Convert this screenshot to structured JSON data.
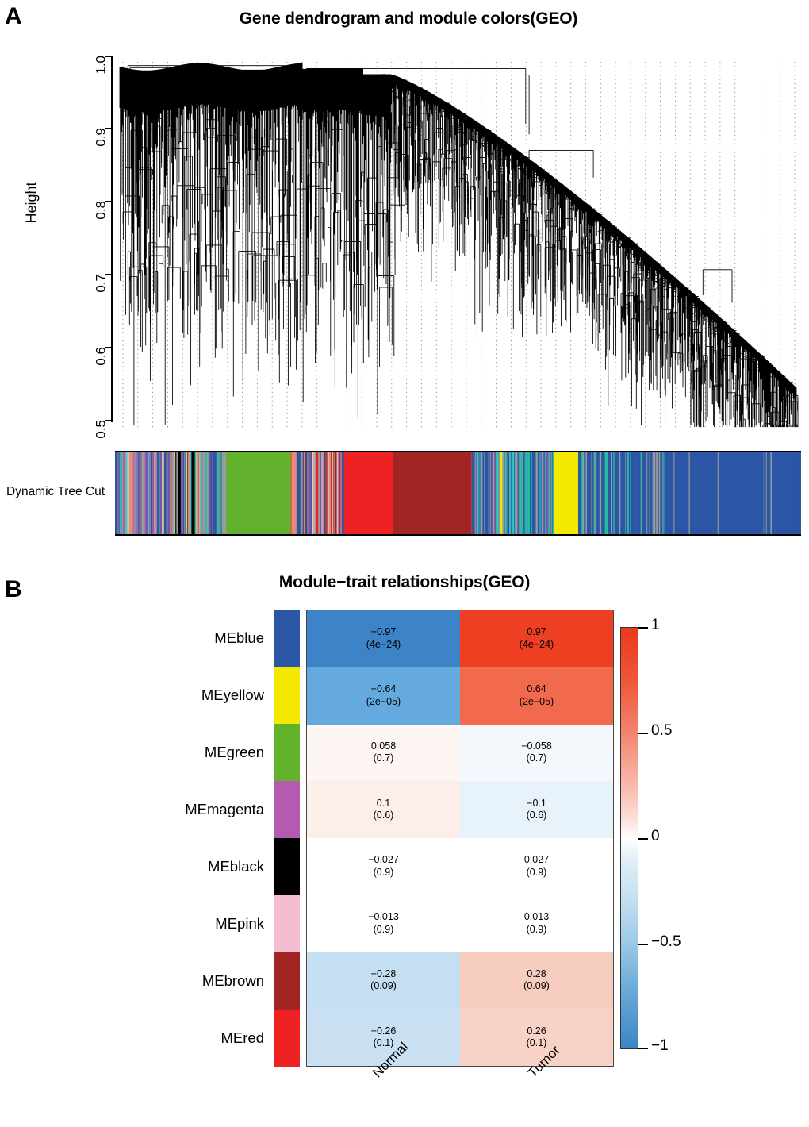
{
  "panels": {
    "a_letter": "A",
    "b_letter": "B"
  },
  "panel_a": {
    "title": "Gene dendrogram and module colors(GEO)",
    "y_axis_label": "Height",
    "y_ticks": [
      "1.0",
      "0.9",
      "0.8",
      "0.7",
      "0.6",
      "0.5"
    ],
    "tree_cut_label": "Dynamic Tree Cut",
    "module_colors": {
      "blue": "#2b56a5",
      "yellow": "#f2e800",
      "green": "#63b22e",
      "magenta": "#b35bb0",
      "black": "#000000",
      "pink": "#f4bcd0",
      "brown": "#a02523",
      "red": "#ee2222",
      "grey": "#9b9b9b",
      "tan": "#cfc49a",
      "salmon": "#e78a7a",
      "purple": "#7b55a5",
      "greenyellow": "#b8d430",
      "cyan": "#40c8c8",
      "turquoise": "#23bfa0"
    }
  },
  "chart_data": [
    {
      "type": "line",
      "name": "gene-dendrogram",
      "title": "Gene dendrogram and module colors(GEO)",
      "xlabel": "",
      "ylabel": "Height",
      "ylim": [
        0.5,
        1.0
      ],
      "yticks": [
        0.5,
        0.6,
        0.7,
        0.8,
        0.9,
        1.0
      ],
      "grid": "vertical dotted gridlines",
      "note": "Hierarchical clustering dendrogram of genes; merge heights between 0.50 and 1.00; dense leaves, large right-hand shoulder descending from ~0.98 to ~0.55",
      "module_color_track": {
        "label": "Dynamic Tree Cut",
        "segments": [
          {
            "color": "blue",
            "start": 0.0,
            "end": 0.028
          },
          {
            "color": "magenta",
            "start": 0.028,
            "end": 0.055
          },
          {
            "color": "blue",
            "start": 0.055,
            "end": 0.062
          },
          {
            "color": "tan",
            "start": 0.062,
            "end": 0.072
          },
          {
            "color": "black",
            "start": 0.072,
            "end": 0.128
          },
          {
            "color": "blue",
            "start": 0.128,
            "end": 0.155
          },
          {
            "color": "green",
            "start": 0.155,
            "end": 0.26
          },
          {
            "color": "blue",
            "start": 0.26,
            "end": 0.288
          },
          {
            "color": "pink",
            "start": 0.288,
            "end": 0.33
          },
          {
            "color": "red",
            "start": 0.33,
            "end": 0.405
          },
          {
            "color": "brown",
            "start": 0.405,
            "end": 0.52
          },
          {
            "color": "blue",
            "start": 0.52,
            "end": 0.56
          },
          {
            "color": "yellow",
            "start": 0.56,
            "end": 0.568
          },
          {
            "color": "blue",
            "start": 0.568,
            "end": 0.64
          },
          {
            "color": "yellow",
            "start": 0.64,
            "end": 0.675
          },
          {
            "color": "blue",
            "start": 0.675,
            "end": 1.0
          }
        ]
      }
    },
    {
      "type": "heatmap",
      "name": "module-trait-relationships",
      "title": "Module−trait relationships(GEO)",
      "rows": [
        "MEblue",
        "MEyellow",
        "MEgreen",
        "MEmagenta",
        "MEblack",
        "MEpink",
        "MEbrown",
        "MEred"
      ],
      "columns": [
        "Normal",
        "Tumor"
      ],
      "row_swatch_colors": [
        "#2b56a5",
        "#f2e800",
        "#63b22e",
        "#b35bb0",
        "#000000",
        "#f4bcd0",
        "#a02523",
        "#ee2222"
      ],
      "values": [
        [
          -0.97,
          0.97
        ],
        [
          -0.64,
          0.64
        ],
        [
          0.058,
          -0.058
        ],
        [
          0.1,
          -0.1
        ],
        [
          -0.027,
          0.027
        ],
        [
          -0.013,
          0.013
        ],
        [
          -0.28,
          0.28
        ],
        [
          -0.26,
          0.26
        ]
      ],
      "pvalues": [
        [
          "4e-24",
          "4e-24"
        ],
        [
          "2e-05",
          "2e-05"
        ],
        [
          "0.7",
          "0.7"
        ],
        [
          "0.6",
          "0.6"
        ],
        [
          "0.9",
          "0.9"
        ],
        [
          "0.9",
          "0.9"
        ],
        [
          "0.09",
          "0.09"
        ],
        [
          "0.1",
          "0.1"
        ]
      ],
      "cell_labels": [
        [
          {
            "corr": "−0.97",
            "pval": "(4e−24)"
          },
          {
            "corr": "0.97",
            "pval": "(4e−24)"
          }
        ],
        [
          {
            "corr": "−0.64",
            "pval": "(2e−05)"
          },
          {
            "corr": "0.64",
            "pval": "(2e−05)"
          }
        ],
        [
          {
            "corr": "0.058",
            "pval": "(0.7)"
          },
          {
            "corr": "−0.058",
            "pval": "(0.7)"
          }
        ],
        [
          {
            "corr": "0.1",
            "pval": "(0.6)"
          },
          {
            "corr": "−0.1",
            "pval": "(0.6)"
          }
        ],
        [
          {
            "corr": "−0.027",
            "pval": "(0.9)"
          },
          {
            "corr": "0.027",
            "pval": "(0.9)"
          }
        ],
        [
          {
            "corr": "−0.013",
            "pval": "(0.9)"
          },
          {
            "corr": "0.013",
            "pval": "(0.9)"
          }
        ],
        [
          {
            "corr": "−0.28",
            "pval": "(0.09)"
          },
          {
            "corr": "0.28",
            "pval": "(0.09)"
          }
        ],
        [
          {
            "corr": "−0.26",
            "pval": "(0.1)"
          },
          {
            "corr": "0.26",
            "pval": "(0.1)"
          }
        ]
      ],
      "cell_colors": [
        [
          "#3c83c8",
          "#ee3f22"
        ],
        [
          "#65aadf",
          "#f26a4d"
        ],
        [
          "#fdf6f3",
          "#f4f8fc"
        ],
        [
          "#fceee9",
          "#e8f2fa"
        ],
        [
          "#ffffff",
          "#ffffff"
        ],
        [
          "#ffffff",
          "#ffffff"
        ],
        [
          "#c4def2",
          "#f7cdc0"
        ],
        [
          "#c9e1f3",
          "#f8d2c6"
        ]
      ],
      "colorbar": {
        "min": -1,
        "max": 1,
        "ticks": [
          "1",
          "0.5",
          "0",
          "−0.5",
          "−1"
        ],
        "tick_values": [
          1,
          0.5,
          0,
          -0.5,
          -1
        ],
        "low_color": "#3b85c6",
        "mid_color": "#ffffff",
        "high_color": "#ea3a1c",
        "position": "right"
      }
    }
  ]
}
